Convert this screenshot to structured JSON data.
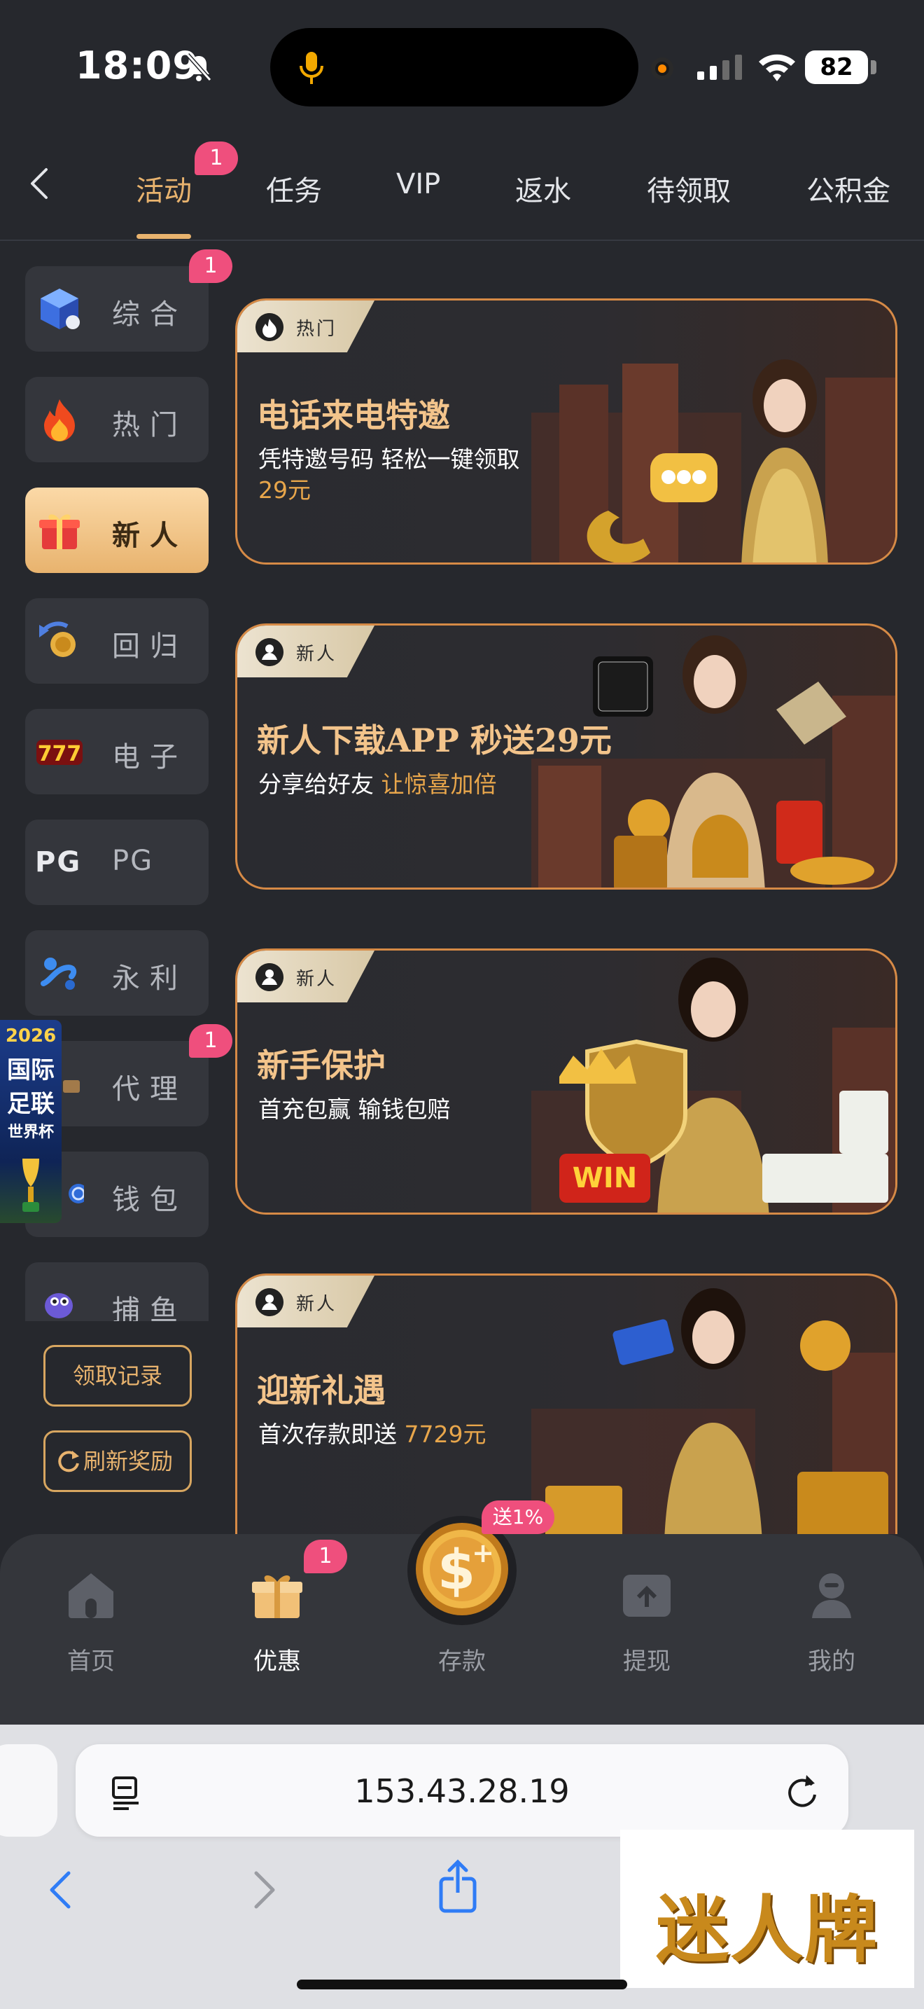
{
  "status": {
    "time": "18:09",
    "battery": "82"
  },
  "tabs": [
    {
      "label": "活动",
      "badge": "1"
    },
    {
      "label": "任务"
    },
    {
      "label": "VIP"
    },
    {
      "label": "返水"
    },
    {
      "label": "待领取"
    },
    {
      "label": "公积金"
    }
  ],
  "sidebar": {
    "items": [
      {
        "label": "综合",
        "badge": "1"
      },
      {
        "label": "热门"
      },
      {
        "label": "新人"
      },
      {
        "label": "回归"
      },
      {
        "label": "电子"
      },
      {
        "label": "PG",
        "icon_text": "PG"
      },
      {
        "label": "永利"
      },
      {
        "label": "代理",
        "badge": "1"
      },
      {
        "label": "钱包"
      },
      {
        "label": "捕鱼"
      }
    ],
    "claim_record": "领取记录",
    "refresh_rewards": "刷新奖励"
  },
  "promo_float": {
    "line1": "2026",
    "line2": "国际",
    "line3": "足联",
    "line4": "世界杯"
  },
  "banners": [
    {
      "tag": "热门",
      "title": "电话来电特邀",
      "subtitle": "凭特邀号码 轻松一键领取",
      "highlight": "29元"
    },
    {
      "tag": "新人",
      "title": "新人下载APP 秒送29元",
      "subtitle_prefix": "分享给好友 ",
      "subtitle_highlight": "让惊喜加倍"
    },
    {
      "tag": "新人",
      "title": "新手保护",
      "subtitle": "首充包赢 输钱包赔"
    },
    {
      "tag": "新人",
      "title": "迎新礼遇",
      "subtitle_prefix": "首次存款即送 ",
      "subtitle_highlight": "7729元"
    }
  ],
  "bottom_nav": {
    "home": "首页",
    "offers": "优惠",
    "offers_badge": "1",
    "deposit": "存款",
    "deposit_bubble": "送1%",
    "withdraw": "提现",
    "mine": "我的"
  },
  "browser": {
    "url": "153.43.28.19"
  },
  "watermark": "迷人牌",
  "colors": {
    "accent": "#e8b36e",
    "badge": "#ef4f7d",
    "banner_border": "#d68a46",
    "background": "#26282d"
  }
}
